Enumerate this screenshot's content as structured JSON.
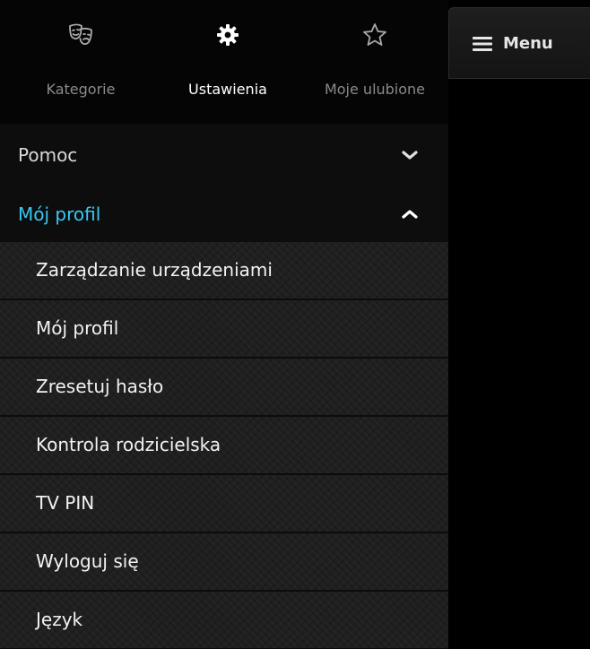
{
  "tabs": [
    {
      "label": "Kategorie",
      "icon": "theater-masks-icon",
      "active": false
    },
    {
      "label": "Ustawienia",
      "icon": "gear-icon",
      "active": true
    },
    {
      "label": "Moje ulubione",
      "icon": "star-icon",
      "active": false
    }
  ],
  "accordion": {
    "help": {
      "label": "Pomoc",
      "expanded": false
    },
    "profile": {
      "label": "Mój profil",
      "expanded": true
    }
  },
  "profile_items": [
    {
      "label": "Zarządzanie urządzeniami"
    },
    {
      "label": "Mój profil"
    },
    {
      "label": "Zresetuj hasło"
    },
    {
      "label": "Kontrola rodzicielska"
    },
    {
      "label": "TV PIN"
    },
    {
      "label": "Wyloguj się"
    },
    {
      "label": "Język"
    }
  ],
  "menu_button": {
    "label": "Menu",
    "icon": "hamburger-icon"
  },
  "colors": {
    "accent": "#3cc6f0",
    "background": "#000000",
    "inactive_text": "#8a8a8a",
    "active_text": "#ffffff"
  }
}
